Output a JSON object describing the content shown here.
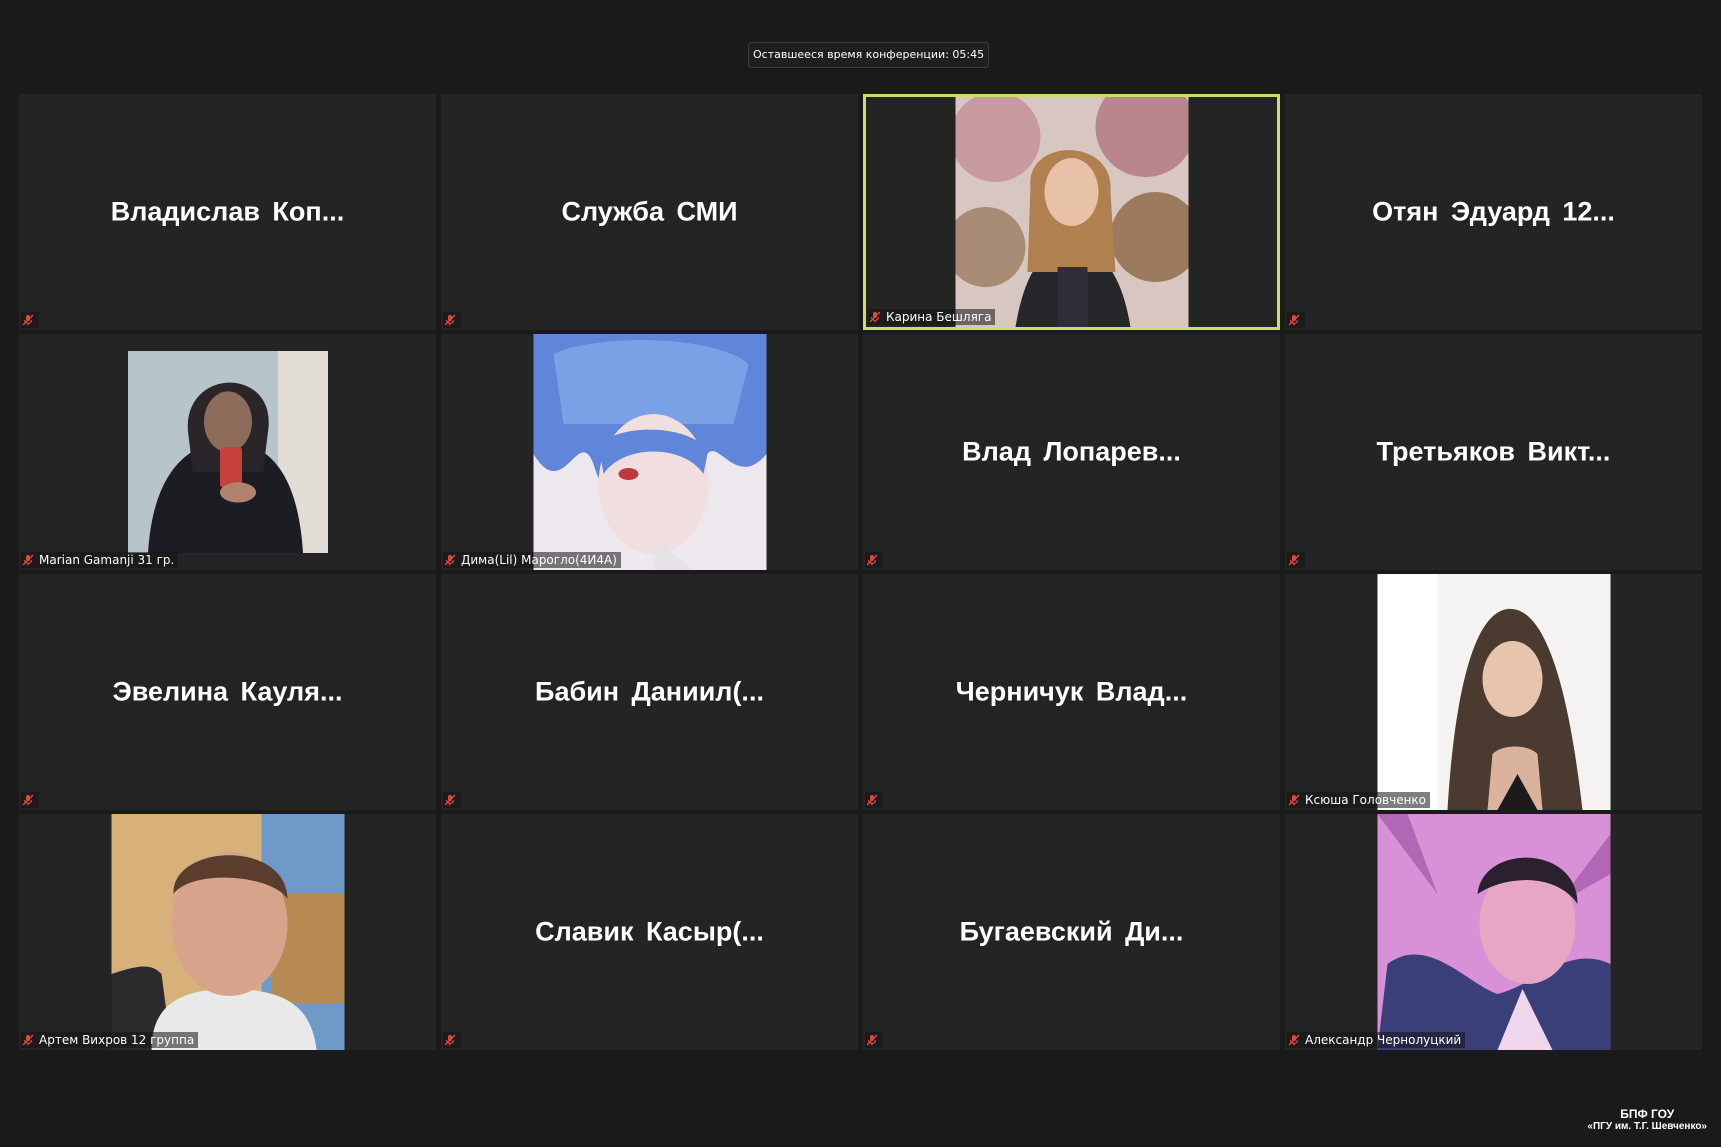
{
  "meeting": {
    "timer_text": "Оставшееся время конференции: 05:45"
  },
  "colors": {
    "background": "#1a1a1a",
    "tile": "#242424",
    "active_speaker_border": "#c8e06a",
    "muted_mic": "#e0483c"
  },
  "participants": [
    {
      "name": "Владислав  Коп...",
      "video": false,
      "muted": true
    },
    {
      "name": "Служба СМИ",
      "video": false,
      "muted": true
    },
    {
      "name": "Карина Бешляга",
      "video": true,
      "muted": true,
      "active": true
    },
    {
      "name": "Отян  Эдуард  12...",
      "video": false,
      "muted": true
    },
    {
      "name": "Marian Gamanji 31 гр.",
      "video": true,
      "muted": true
    },
    {
      "name": "Дима(Lil) Марогло(4И4А)",
      "video": true,
      "muted": true
    },
    {
      "name": "Влад  Лопарев...",
      "video": false,
      "muted": true
    },
    {
      "name": "Третьяков  Викт...",
      "video": false,
      "muted": true
    },
    {
      "name": "Эвелина  Кауля...",
      "video": false,
      "muted": true
    },
    {
      "name": "Бабин  Даниил(...",
      "video": false,
      "muted": true
    },
    {
      "name": "Черничук  Влад...",
      "video": false,
      "muted": true
    },
    {
      "name": "Ксюша Головченко",
      "video": true,
      "muted": true
    },
    {
      "name": "Артем Вихров 12 группа",
      "video": true,
      "muted": true
    },
    {
      "name": "Славик  Касыр(...",
      "video": false,
      "muted": true
    },
    {
      "name": "Бугаевский  Ди...",
      "video": false,
      "muted": true
    },
    {
      "name": "Александр Чернолуцкий",
      "video": true,
      "muted": true
    }
  ],
  "watermark": {
    "line1": "БПФ ГОУ",
    "line2": "«ПГУ им. Т.Г. Шевченко»"
  }
}
